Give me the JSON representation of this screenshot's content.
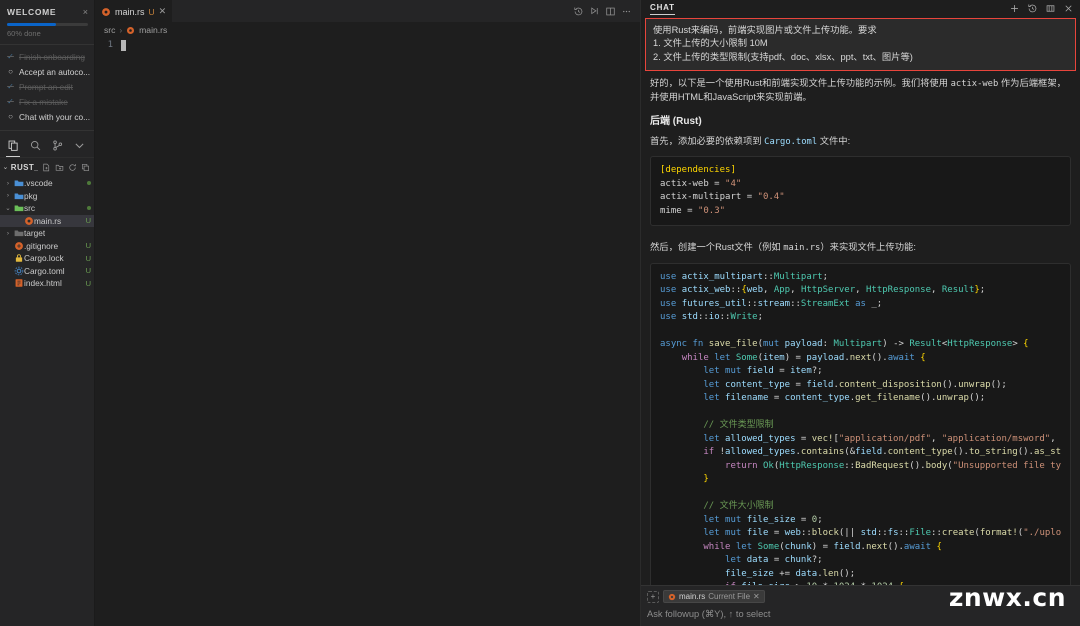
{
  "welcome": {
    "title": "WELCOME",
    "close_label": "×",
    "progress_percent": 60,
    "progress_label": "60% done",
    "steps": [
      {
        "label": "Finish onboarding",
        "done": true,
        "mark": "✓"
      },
      {
        "label": "Accept an autoco...",
        "done": false,
        "mark": "○"
      },
      {
        "label": "Prompt an edit",
        "done": true,
        "mark": "✓"
      },
      {
        "label": "Fix a mistake",
        "done": true,
        "mark": "✓"
      },
      {
        "label": "Chat with your co...",
        "done": false,
        "mark": "○"
      }
    ]
  },
  "activity_bar": {
    "items": [
      {
        "name": "explorer-icon",
        "active": true
      },
      {
        "name": "search-icon",
        "active": false
      },
      {
        "name": "source-control-icon",
        "active": false
      },
      {
        "name": "chevron-down-icon",
        "active": false
      }
    ]
  },
  "explorer": {
    "chevron": "⌄",
    "folder_name": "RUST_...",
    "actions": [
      "new-file-icon",
      "new-folder-icon",
      "refresh-icon",
      "collapse-all-icon"
    ],
    "tree": [
      {
        "name": ".vscode",
        "type": "folder",
        "indent": 1,
        "twisty": "›",
        "icon_color": "#4a8fd4",
        "status": "",
        "modified": true,
        "selected": false
      },
      {
        "name": "pkg",
        "type": "folder",
        "indent": 1,
        "twisty": "›",
        "icon_color": "#4a8fd4",
        "status": "",
        "modified": false,
        "selected": false
      },
      {
        "name": "src",
        "type": "folder",
        "indent": 1,
        "twisty": "⌄",
        "icon_color": "#6bbf59",
        "status": "",
        "modified": true,
        "selected": false
      },
      {
        "name": "main.rs",
        "type": "rust",
        "indent": 2,
        "twisty": "",
        "icon_color": "#d4622a",
        "status": "U",
        "modified": false,
        "selected": true
      },
      {
        "name": "target",
        "type": "folder",
        "indent": 1,
        "twisty": "›",
        "icon_color": "#6d6d6d",
        "status": "",
        "modified": false,
        "selected": false
      },
      {
        "name": ".gitignore",
        "type": "git",
        "indent": 1,
        "twisty": "",
        "icon_color": "#d4622a",
        "status": "U",
        "modified": false,
        "selected": false
      },
      {
        "name": "Cargo.lock",
        "type": "lock",
        "indent": 1,
        "twisty": "",
        "icon_color": "#e2b93d",
        "status": "U",
        "modified": false,
        "selected": false
      },
      {
        "name": "Cargo.toml",
        "type": "toml",
        "indent": 1,
        "twisty": "",
        "icon_color": "#4a8fd4",
        "status": "U",
        "modified": false,
        "selected": false
      },
      {
        "name": "index.html",
        "type": "html",
        "indent": 1,
        "twisty": "",
        "icon_color": "#d4622a",
        "status": "U",
        "modified": false,
        "selected": false
      }
    ]
  },
  "editor": {
    "tab": {
      "filename": "main.rs",
      "status": "U",
      "close": "✕"
    },
    "toolbar_icons": [
      "history-icon",
      "run-icon",
      "split-editor-icon",
      "more-actions-icon"
    ],
    "breadcrumb": {
      "folder": "src",
      "separator": "›",
      "file": "main.rs"
    },
    "line_numbers": [
      "1"
    ],
    "line_content": ""
  },
  "chat": {
    "tab_label": "CHAT",
    "actions": [
      "new-chat-icon",
      "history-icon",
      "maximize-icon",
      "close-icon"
    ],
    "user_message": {
      "lines": [
        "使用Rust来编码，前端实现图片或文件上传功能。要求",
        "1. 文件上传的大小限制 10M",
        "2. 文件上传的类型限制(支持pdf、doc、xlsx、ppt、txt、图片等)"
      ],
      "border_color": "#e8453c"
    },
    "response": {
      "intro_a": "好的，以下是一个使用Rust和前端实现文件上传功能的示例。我们将使用 ",
      "intro_code": "actix-web",
      "intro_b": " 作为后端框架，并使用HTML和JavaScript来实现前端。",
      "heading": "后端 (Rust)",
      "deps_text_a": "首先，添加必要的依赖项到 ",
      "deps_code": "Cargo.toml",
      "deps_text_b": " 文件中:",
      "toml_block": "[dependencies]\nactix-web = \"4\"\nactix-multipart = \"0.4\"\nmime = \"0.3\"",
      "then_text_a": "然后，创建一个Rust文件（例如 ",
      "then_code": "main.rs",
      "then_text_b": "）来实现文件上传功能:"
    }
  },
  "chat_input": {
    "chip_plus": "+",
    "chip_file": "main.rs",
    "chip_context": "Current File",
    "chip_close": "✕",
    "placeholder": "Ask followup (⌘Y), ↑ to select"
  },
  "watermark": "znwx.cn"
}
